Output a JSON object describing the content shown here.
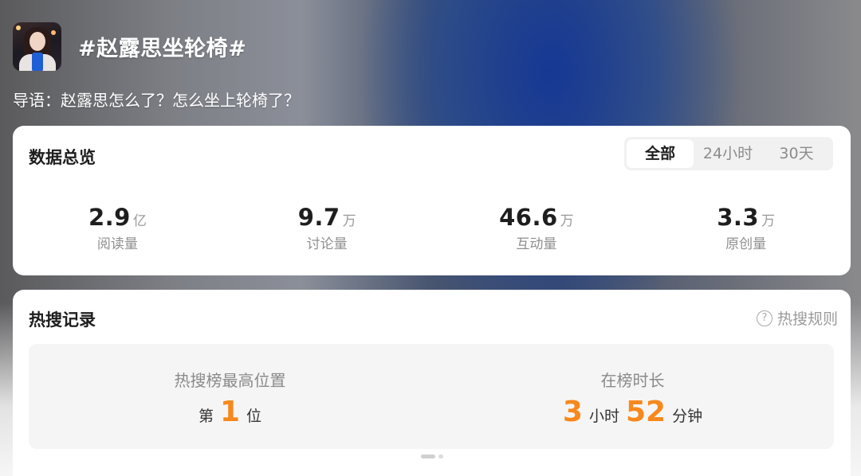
{
  "topic": {
    "title": "#赵露思坐轮椅#",
    "intro": "导语：赵露思怎么了？怎么坐上轮椅了？"
  },
  "overview": {
    "title": "数据总览",
    "tabs": [
      {
        "label": "全部",
        "active": true
      },
      {
        "label": "24小时",
        "active": false
      },
      {
        "label": "30天",
        "active": false
      }
    ],
    "stats": [
      {
        "value": "2.9",
        "unit": "亿",
        "label": "阅读量"
      },
      {
        "value": "9.7",
        "unit": "万",
        "label": "讨论量"
      },
      {
        "value": "46.6",
        "unit": "万",
        "label": "互动量"
      },
      {
        "value": "3.3",
        "unit": "万",
        "label": "原创量"
      }
    ]
  },
  "hot_record": {
    "title": "热搜记录",
    "rules_label": "热搜规则",
    "help_icon": "question-circle-icon",
    "peak": {
      "label": "热搜榜最高位置",
      "prefix": "第",
      "value": "1",
      "suffix": "位"
    },
    "duration": {
      "label": "在榜时长",
      "hours": "3",
      "hours_unit": "小时",
      "minutes": "52",
      "minutes_unit": "分钟"
    },
    "pager": {
      "pages": 2,
      "current": 1
    }
  },
  "colors": {
    "accent_orange": "#f7881c",
    "card_bg": "#ffffff",
    "tab_track": "#f1f1f1"
  }
}
